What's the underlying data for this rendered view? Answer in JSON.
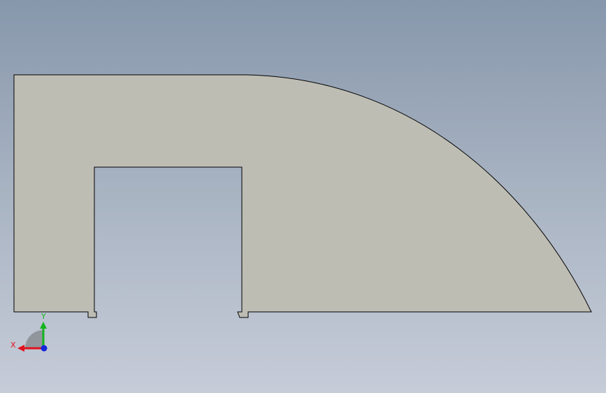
{
  "viewport": {
    "background_top": "#8797ab",
    "background_bottom": "#c6ccd8"
  },
  "part": {
    "fill_color": "#bebdb4",
    "edge_color": "#000000"
  },
  "triad": {
    "x_label": "X",
    "y_label": "Y",
    "x_color": "#e0141e",
    "y_color": "#14b41e",
    "z_color": "#1428dc",
    "plane_color": "#8a8d93",
    "icon": "axis-triad-icon"
  }
}
